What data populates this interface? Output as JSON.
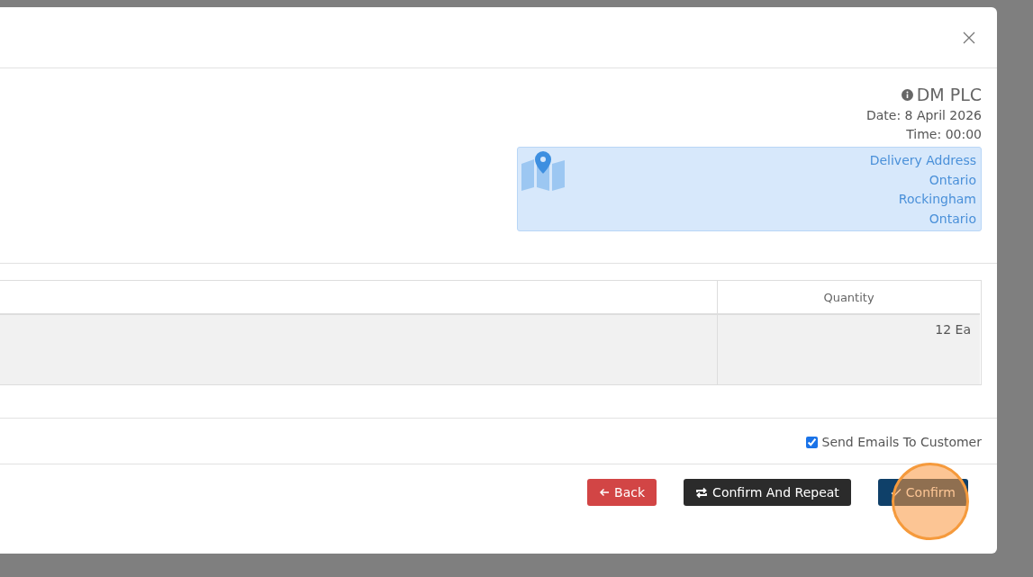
{
  "company": {
    "name": "DM PLC",
    "date": "Date: 8 April 2026",
    "time": "Time: 00:00"
  },
  "delivery_address": [
    "Delivery Address",
    "Ontario",
    "Rockingham",
    "Ontario"
  ],
  "table": {
    "columns": [
      "Quantity"
    ],
    "rows": [
      {
        "quantity": "12 Ea"
      }
    ]
  },
  "send_emails": {
    "label": "Send Emails To Customer",
    "checked": true
  },
  "buttons": [
    {
      "label": "Back",
      "kind": "danger"
    },
    {
      "label": "Confirm And Repeat",
      "kind": "dark"
    },
    {
      "label": "Confirm",
      "kind": "primary",
      "highlighted": true
    }
  ]
}
